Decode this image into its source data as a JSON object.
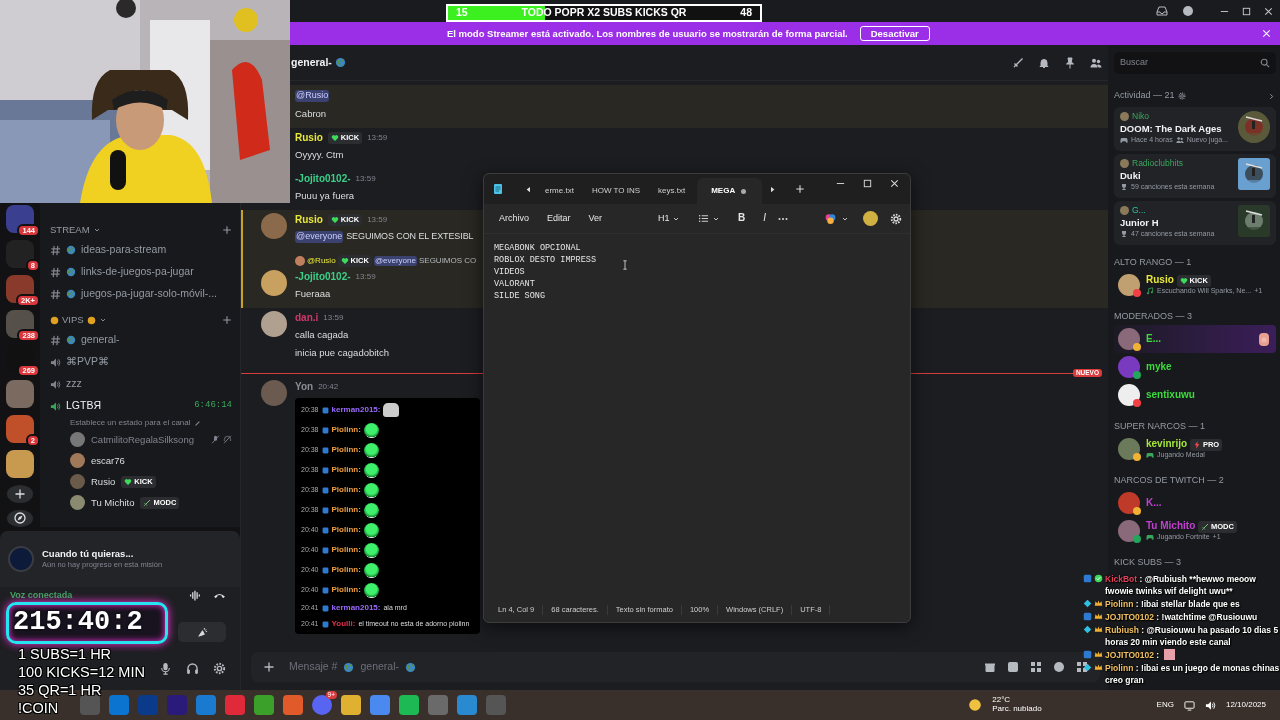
{
  "title_bar": {
    "goal": {
      "current": "15",
      "label": "TODO POPR X2 SUBS KICKS QR",
      "target": "48",
      "level": 0.31
    }
  },
  "streamer_banner": {
    "message": "El modo Streamer está activado. Los nombres de usuario se mostrarán de forma parcial.",
    "button": "Desactivar"
  },
  "servers": [
    {
      "kind": "server",
      "badge": "144"
    },
    {
      "kind": "server",
      "badge": "8"
    },
    {
      "kind": "server",
      "badge": "2K+"
    },
    {
      "kind": "server",
      "badge": "238"
    },
    {
      "kind": "server",
      "badge": "269"
    },
    {
      "kind": "server"
    },
    {
      "kind": "server",
      "badge": "2"
    },
    {
      "kind": "server"
    }
  ],
  "channel_groups": [
    {
      "name": "STREAM",
      "channels": [
        {
          "kind": "text",
          "name": "ideas-para-stream"
        },
        {
          "kind": "text",
          "name": "links-de-juegos-pa-jugar"
        },
        {
          "kind": "text",
          "name": "juegos-pa-jugar-solo-móvil-..."
        }
      ]
    },
    {
      "name": "VIPS",
      "channels": [
        {
          "kind": "text",
          "name": "general-"
        },
        {
          "kind": "voice",
          "name": "⌘PVP⌘"
        },
        {
          "kind": "voice",
          "name": "zzz"
        },
        {
          "kind": "voice",
          "name": "LGTBЯ",
          "active": true,
          "time": "6:46:14",
          "status": "Establece un estado para el canal",
          "members": [
            {
              "name": "CatmilitoRegalaSilksong",
              "muted": true
            },
            {
              "name": "escar76",
              "muted": false
            },
            {
              "name": "Rusio",
              "muted": false,
              "tag": {
                "label": "KICK",
                "kind": "heart"
              }
            },
            {
              "name": "Tu Michito",
              "muted": false,
              "tag": {
                "label": "MODC",
                "kind": "sword"
              }
            }
          ]
        }
      ]
    }
  ],
  "mission": {
    "title": "Cuando tú quieras...",
    "subtitle": "Aún no hay progreso en esta misión"
  },
  "voice_panel": {
    "status": "Voz conectada"
  },
  "countdown": {
    "time": "215:40:2"
  },
  "goal_lines": [
    "1 SUBS=1 HR",
    "100 KICKS=12 MIN",
    "35 QR=1 HR",
    "!COIN"
  ],
  "chat": {
    "channel": "general-",
    "placeholder_prefix": "Mensaje #",
    "placeholder_channel": "general-",
    "messages": [
      {
        "kind": "continuation",
        "mention": "@Rusio",
        "lines": [
          "Cabron"
        ],
        "highlighted": true
      },
      {
        "kind": "message",
        "author": "Rusio",
        "color": "#e8e83a",
        "tag": {
          "label": "KICK",
          "kind": "heart"
        },
        "time": "13:59",
        "lines": [
          "Oyyyy. Ctm"
        ],
        "highlighted": false
      },
      {
        "kind": "message",
        "author": "-Jojito0102-",
        "color": "#3ad08a",
        "time": "13:59",
        "lines": [
          "Puuu ya fuera"
        ],
        "highlighted": false
      },
      {
        "kind": "message",
        "author": "Rusio",
        "avatar": true,
        "color": "#e8e83a",
        "tag": {
          "label": "KICK",
          "kind": "heart"
        },
        "time": "13:59",
        "mention": "@everyone",
        "lines": [
          "SEGUIMOS CON EL EXTESIBL"
        ],
        "highlighted": true
      },
      {
        "kind": "message",
        "reply": {
          "author": "@Rusio",
          "tag": {
            "label": "KICK",
            "kind": "heart"
          },
          "mention": "@everyone",
          "text": "SEGUIMOS CO"
        },
        "author": "-Jojito0102-",
        "avatar": true,
        "color": "#3ad08a",
        "time": "13:59",
        "lines": [
          "Fueraaa"
        ],
        "highlighted": true
      },
      {
        "kind": "message",
        "author": "dan.i",
        "avatar": true,
        "color": "#d0386a",
        "time": "13:59",
        "lines": [
          "calla cagada",
          "inicia pue cagadobitch"
        ],
        "highlighted": false
      },
      {
        "kind": "divider",
        "label": "NUEVO"
      },
      {
        "kind": "embed",
        "author": "Yon",
        "avatar": true,
        "color": "#8a8d93",
        "time": "20:42",
        "embed_lines": [
          {
            "kind": "cat",
            "time": "20:38",
            "user": "kerman2015:",
            "color": "#9b6bff"
          },
          {
            "kind": "round",
            "time": "20:38",
            "user": "Piolinn:",
            "color": "#f0a040"
          },
          {
            "kind": "round",
            "time": "20:38",
            "user": "Piolinn:",
            "color": "#f0a040"
          },
          {
            "kind": "round",
            "time": "20:38",
            "user": "Piolinn:",
            "color": "#f0a040"
          },
          {
            "kind": "round",
            "time": "20:38",
            "user": "Piolinn:",
            "color": "#f0a040"
          },
          {
            "kind": "round",
            "time": "20:38",
            "user": "Piolinn:",
            "color": "#f0a040"
          },
          {
            "kind": "round",
            "time": "20:40",
            "user": "Piolinn:",
            "color": "#f0a040"
          },
          {
            "kind": "round",
            "time": "20:40",
            "user": "Piolinn:",
            "color": "#f0a040"
          },
          {
            "kind": "round",
            "time": "20:40",
            "user": "Piolinn:",
            "color": "#f0a040"
          },
          {
            "kind": "round",
            "time": "20:40",
            "user": "Piolinn:",
            "color": "#f0a040"
          },
          {
            "kind": "text",
            "time": "20:41",
            "user": "kerman2015:",
            "color": "#9b6bff",
            "text": "ala mrd"
          },
          {
            "kind": "text",
            "time": "20:41",
            "user": "Youlli:",
            "color": "#e0304a",
            "text": "el timeout no esta de adorno piolinn"
          }
        ]
      }
    ]
  },
  "search": {
    "placeholder": "Buscar"
  },
  "activity": {
    "title": "Actividad — 21",
    "cards": [
      {
        "user": "Niko",
        "title": "DOOM: The Dark Ages",
        "details": [
          {
            "kind": "gamepad",
            "text": "Hace 4 horas"
          },
          {
            "kind": "people",
            "text": "Nuevo juga..."
          }
        ]
      },
      {
        "user": "Radioclubhits",
        "title": "Duki",
        "details": [
          {
            "kind": "trophy",
            "text": "59 canciones esta semana"
          }
        ]
      },
      {
        "user": "G...",
        "title": "Junior H",
        "details": [
          {
            "kind": "trophy",
            "text": "47 canciones esta semana"
          }
        ]
      }
    ]
  },
  "member_groups": [
    {
      "name": "ALTO RANGO — 1",
      "members": [
        {
          "name": "Rusio",
          "color": "#e8e83a",
          "status": {
            "color": "#f23f43"
          },
          "tag": {
            "label": "KICK",
            "kind": "heart"
          },
          "activity": {
            "kind": "music",
            "text": "Escuchando Will Sparks, Ne...",
            "extra": "+1"
          }
        }
      ]
    },
    {
      "name": "MODERADOS — 3",
      "members": [
        {
          "name": "E...",
          "color": "#3cdc3c",
          "status": {
            "color": "#f0b232"
          },
          "highlighted": true
        },
        {
          "name": "myke",
          "color": "#3cdc3c",
          "status": {
            "color": "#23a55a"
          }
        },
        {
          "name": "sentixuwu",
          "color": "#3cdc3c",
          "status": {
            "color": "#f23f43"
          }
        }
      ]
    },
    {
      "name": "SUPER NARCOS — 1",
      "members": [
        {
          "name": "kevinrijo",
          "color": "#a6e83a",
          "status": {
            "color": "#f0b232"
          },
          "tag": {
            "label": "PRO",
            "kind": "bolt"
          },
          "activity": {
            "kind": "gamepad",
            "text": "Jugando Medal"
          }
        }
      ]
    },
    {
      "name": "NARCOS DE TWITCH — 2",
      "members": [
        {
          "name": "K...",
          "color": "#c040d0",
          "status": {
            "color": "#f0b232"
          }
        },
        {
          "name": "Tu Michito",
          "color": "#c040d0",
          "status": {
            "color": "#23a55a"
          },
          "tag": {
            "label": "MODC",
            "kind": "sword"
          },
          "activity": {
            "kind": "gamepad",
            "text": "Jugando Fortnite",
            "extra": "+1"
          }
        }
      ]
    },
    {
      "name": "KICK SUBS — 3"
    }
  ],
  "notepad": {
    "tabs": [
      {
        "label": "erme.txt",
        "selected": false,
        "unsaved": false
      },
      {
        "label": "HOW TO INS",
        "selected": false,
        "unsaved": false
      },
      {
        "label": "keys.txt",
        "selected": false,
        "unsaved": false
      },
      {
        "label": "MEGA",
        "selected": true,
        "unsaved": true
      }
    ],
    "menu": [
      "Archivo",
      "Editar",
      "Ver"
    ],
    "heading": "H1",
    "format": [
      "B",
      "I"
    ],
    "lines": [
      "MEGABONK OPCIONAL",
      "ROBLOX DESTO IMPRESS",
      "VIDEOS",
      "VALORANT",
      "SILDE SONG"
    ],
    "status": [
      "Ln 4, Col 9",
      "68 caracteres.",
      "Texto sin formato",
      "100%",
      "Windows (CRLF)",
      "UTF-8"
    ]
  },
  "kick_chat": [
    {
      "user": "KickBot",
      "color": "#e0405a",
      "text": ": @Rubiush **hewwo meoow fwowie twinks wif delight uwu**"
    },
    {
      "user": "Piolinn",
      "color": "#f0c060",
      "text": ": !ibai stellar blade que es"
    },
    {
      "user": "JOJITO0102",
      "color": "#f0c060",
      "text": ": !watchtime @Rusiouwu"
    },
    {
      "user": "Rubiush",
      "color": "#f0c060",
      "text": ": @Rusiouwu ha pasado 10 dias 5 horas 20 min viendo este canal"
    },
    {
      "user": "JOJITO0102",
      "color": "#f0c060",
      "text": ":"
    },
    {
      "user": "Piolinn",
      "color": "#f0c060",
      "text": ": !ibai es un juego de monas chinas creo gran"
    }
  ],
  "taskbar": {
    "notification_badge": "9+",
    "temperature": "22°C",
    "weather": "Parc. nublado",
    "language": "ENG",
    "date": "12/10/2025"
  }
}
